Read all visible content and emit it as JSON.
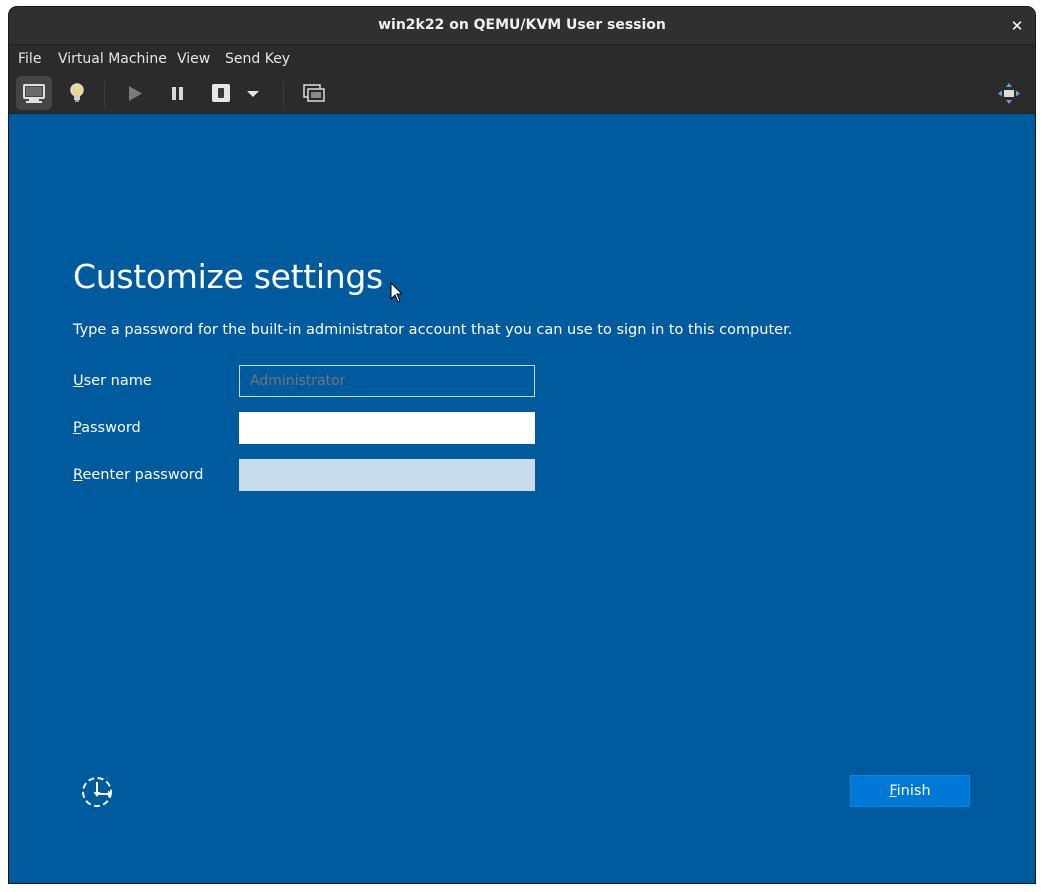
{
  "window": {
    "title": "win2k22 on QEMU/KVM User session",
    "close_glyph": "✕"
  },
  "menubar": {
    "items": [
      "File",
      "Virtual Machine",
      "View",
      "Send Key"
    ]
  },
  "toolbar": {
    "buttons": [
      {
        "icon": "console-icon",
        "active": true
      },
      {
        "icon": "details-lightbulb-icon",
        "active": false
      },
      {
        "icon": "run-play-icon",
        "active": false
      },
      {
        "icon": "pause-icon",
        "active": false
      },
      {
        "icon": "shutdown-icon",
        "active": false
      },
      {
        "icon": "dropdown-arrow-icon",
        "active": false
      },
      {
        "icon": "snapshots-icon",
        "active": false
      },
      {
        "icon": "fullscreen-icon",
        "active": false
      }
    ]
  },
  "setup": {
    "title": "Customize settings",
    "instructions": "Type a password for the built-in administrator account that you can use to sign in to this computer.",
    "username": {
      "label_key": "U",
      "label_rest": "ser name",
      "placeholder": "Administrator",
      "value": ""
    },
    "password": {
      "label_key": "P",
      "label_rest": "assword",
      "value": ""
    },
    "reenter": {
      "label_key": "R",
      "label_rest": "eenter password",
      "value": ""
    },
    "finish": {
      "label_key": "F",
      "label_rest": "inish"
    },
    "accessibility_icon": "ease-of-access-icon"
  },
  "colors": {
    "vm_background": "#005a9e",
    "finish_button": "#0078d7",
    "titlebar": "#303030"
  }
}
